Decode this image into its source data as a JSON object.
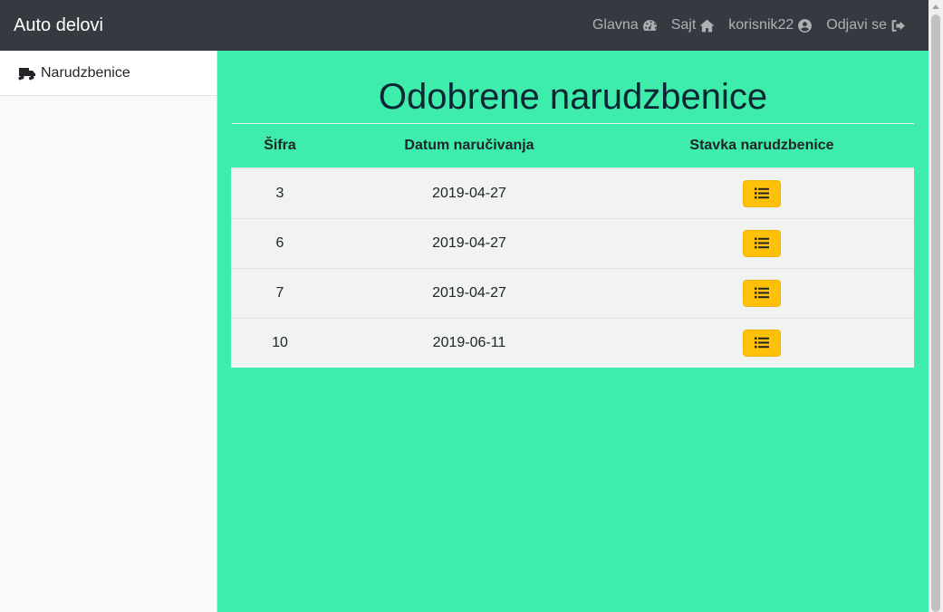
{
  "navbar": {
    "brand": "Auto delovi",
    "links": [
      {
        "label": "Glavna",
        "icon": "tachometer-icon"
      },
      {
        "label": "Sajt",
        "icon": "home-icon"
      },
      {
        "label": "korisnik22",
        "icon": "user-circle-icon"
      },
      {
        "label": "Odjavi se",
        "icon": "sign-out-icon"
      }
    ]
  },
  "sidebar": {
    "items": [
      {
        "label": "Narudzbenice",
        "icon": "truck-icon"
      }
    ]
  },
  "main": {
    "title": "Odobrene narudzbenice",
    "table": {
      "headers": [
        "Šifra",
        "Datum naručivanja",
        "Stavka narudzbenice"
      ],
      "rows": [
        {
          "sifra": "3",
          "datum": "2019-04-27",
          "action_icon": "list-icon"
        },
        {
          "sifra": "6",
          "datum": "2019-04-27",
          "action_icon": "list-icon"
        },
        {
          "sifra": "7",
          "datum": "2019-04-27",
          "action_icon": "list-icon"
        },
        {
          "sifra": "10",
          "datum": "2019-06-11",
          "action_icon": "list-icon"
        }
      ]
    }
  },
  "colors": {
    "navbar_bg": "#343a40",
    "main_bg": "#3eedac",
    "button_bg": "#ffc107",
    "sidebar_bg": "#f8f9fa"
  }
}
